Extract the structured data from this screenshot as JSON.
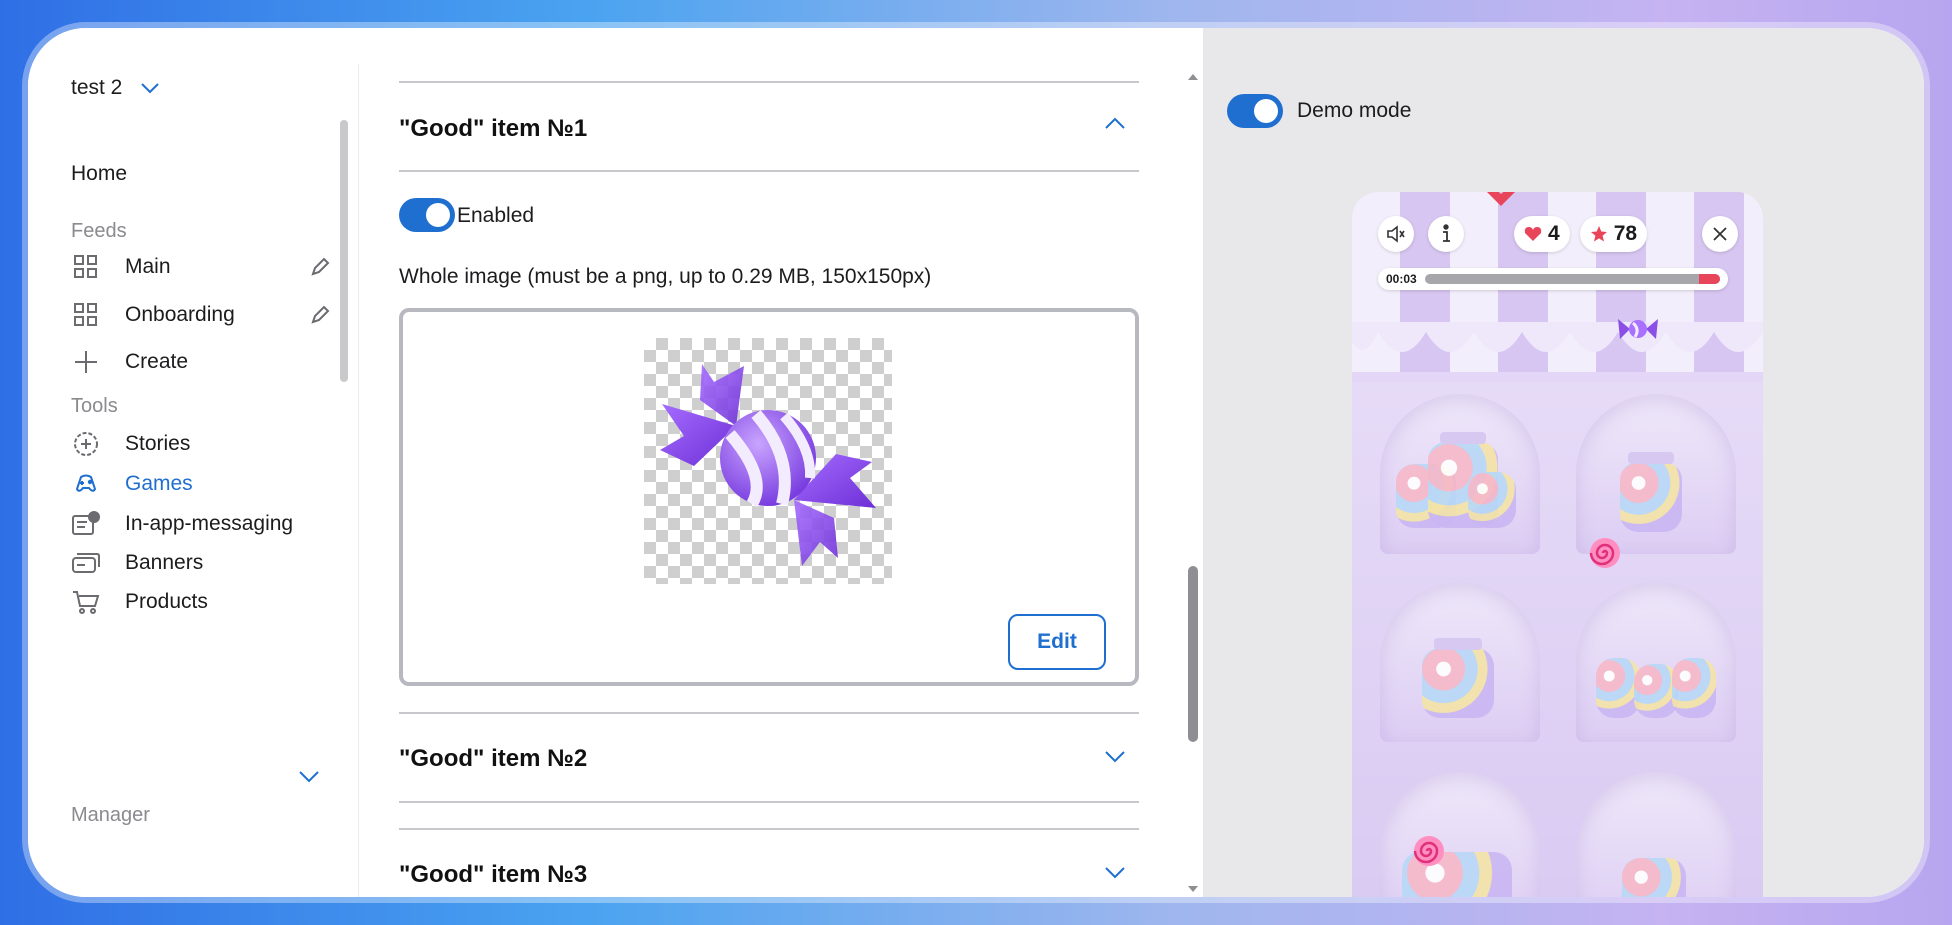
{
  "sidebar": {
    "project_name": "test 2",
    "home_label": "Home",
    "feeds_label": "Feeds",
    "feeds": [
      {
        "label": "Main"
      },
      {
        "label": "Onboarding"
      }
    ],
    "create_label": "Create",
    "tools_label": "Tools",
    "tools": [
      {
        "label": "Stories"
      },
      {
        "label": "Games"
      },
      {
        "label": "In-app-messaging"
      },
      {
        "label": "Banners"
      },
      {
        "label": "Products"
      }
    ],
    "active_item": "Games",
    "manager_label": "Manager"
  },
  "editor": {
    "items": [
      {
        "title": "\"Good\" item №1",
        "expanded": true
      },
      {
        "title": "\"Good\" item №2",
        "expanded": false
      },
      {
        "title": "\"Good\" item №3",
        "expanded": false
      }
    ],
    "enabled_label": "Enabled",
    "enabled": true,
    "image_description": "Whole image (must be a png, up to 0.29 MB, 150x150px)",
    "edit_label": "Edit"
  },
  "preview": {
    "demo_mode_label": "Demo mode",
    "demo_mode": true,
    "game": {
      "lives": "4",
      "score": "78",
      "timer": "00:03",
      "timer_progress": 0.93
    }
  },
  "colors": {
    "accent": "#1f6fd1",
    "timer_red": "#e8455a",
    "candy_purple": "#8b4fe6"
  }
}
